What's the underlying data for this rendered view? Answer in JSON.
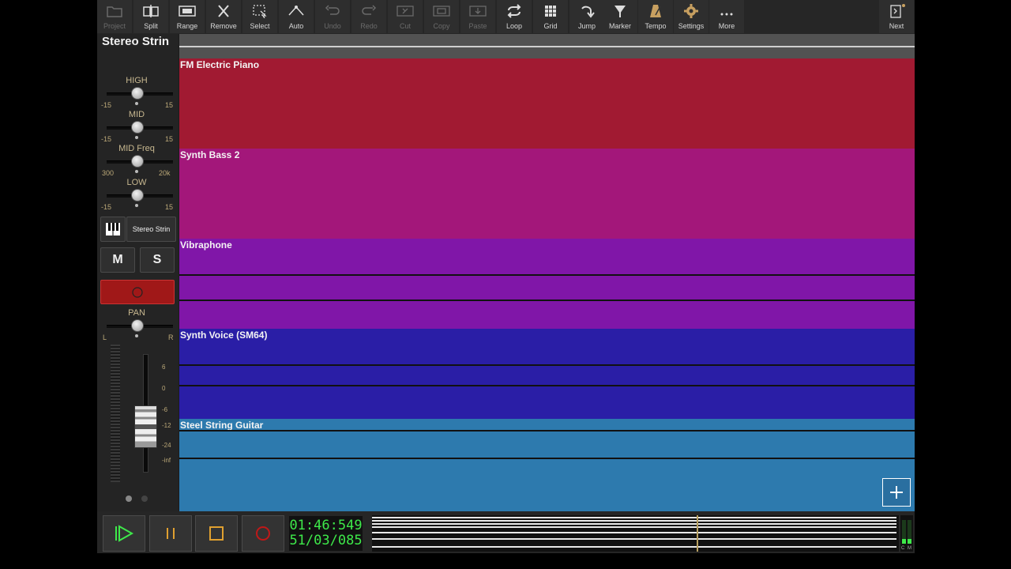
{
  "toolbar": {
    "items": [
      {
        "id": "project",
        "label": "Project",
        "icon": "folder-icon",
        "enabled": false
      },
      {
        "id": "split",
        "label": "Split",
        "icon": "split-icon",
        "enabled": true
      },
      {
        "id": "range",
        "label": "Range",
        "icon": "range-icon",
        "enabled": true
      },
      {
        "id": "remove",
        "label": "Remove",
        "icon": "x-icon",
        "enabled": true
      },
      {
        "id": "select",
        "label": "Select",
        "icon": "select-icon",
        "enabled": true
      },
      {
        "id": "auto",
        "label": "Auto",
        "icon": "automation-icon",
        "enabled": true
      },
      {
        "id": "undo",
        "label": "Undo",
        "icon": "undo-icon",
        "enabled": false
      },
      {
        "id": "redo",
        "label": "Redo",
        "icon": "redo-icon",
        "enabled": false
      },
      {
        "id": "cut",
        "label": "Cut",
        "icon": "cut-icon",
        "enabled": false
      },
      {
        "id": "copy",
        "label": "Copy",
        "icon": "copy-icon",
        "enabled": false
      },
      {
        "id": "paste",
        "label": "Paste",
        "icon": "paste-icon",
        "enabled": false
      },
      {
        "id": "loop",
        "label": "Loop",
        "icon": "loop-icon",
        "enabled": true
      },
      {
        "id": "grid",
        "label": "Grid",
        "icon": "grid-icon",
        "enabled": true
      },
      {
        "id": "jump",
        "label": "Jump",
        "icon": "jump-icon",
        "enabled": true
      },
      {
        "id": "marker",
        "label": "Marker",
        "icon": "marker-icon",
        "enabled": true
      },
      {
        "id": "tempo",
        "label": "Tempo",
        "icon": "metronome-icon",
        "enabled": true
      },
      {
        "id": "settings",
        "label": "Settings",
        "icon": "gear-icon",
        "enabled": true
      },
      {
        "id": "more",
        "label": "More",
        "icon": "ellipsis-icon",
        "enabled": true
      }
    ],
    "next": {
      "label": "Next",
      "icon": "next-panel-icon"
    }
  },
  "strip": {
    "name": "Stereo Strin",
    "eq": [
      {
        "label": "HIGH",
        "min": "-15",
        "max": "15",
        "value": 0.5
      },
      {
        "label": "MID",
        "min": "-15",
        "max": "15",
        "value": 0.5
      },
      {
        "label": "MID Freq",
        "min": "300",
        "max": "20k",
        "value": 0.5
      },
      {
        "label": "LOW",
        "min": "-15",
        "max": "15",
        "value": 0.5
      }
    ],
    "instrument_label": "Stereo Strin",
    "mute_label": "M",
    "solo_label": "S",
    "pan": {
      "label": "PAN",
      "left": "L",
      "right": "R",
      "value": 0.5
    },
    "fader_scale": [
      "6",
      "0",
      "-6",
      "-12",
      "-24",
      "-inf"
    ]
  },
  "tracks": [
    {
      "name": "FM Electric Piano",
      "color": "#a11a32"
    },
    {
      "name": "Synth Bass 2",
      "color": "#a3177a"
    },
    {
      "name": "Vibraphone",
      "color": "#8016a8"
    },
    {
      "name": "Synth Voice (SM64)",
      "color": "#2a1ea6"
    },
    {
      "name": "Steel String Guitar",
      "color": "#2d7aae"
    }
  ],
  "transport": {
    "time": "01:46:549",
    "position": "51/03/085"
  },
  "meter": {
    "label": "C M"
  }
}
